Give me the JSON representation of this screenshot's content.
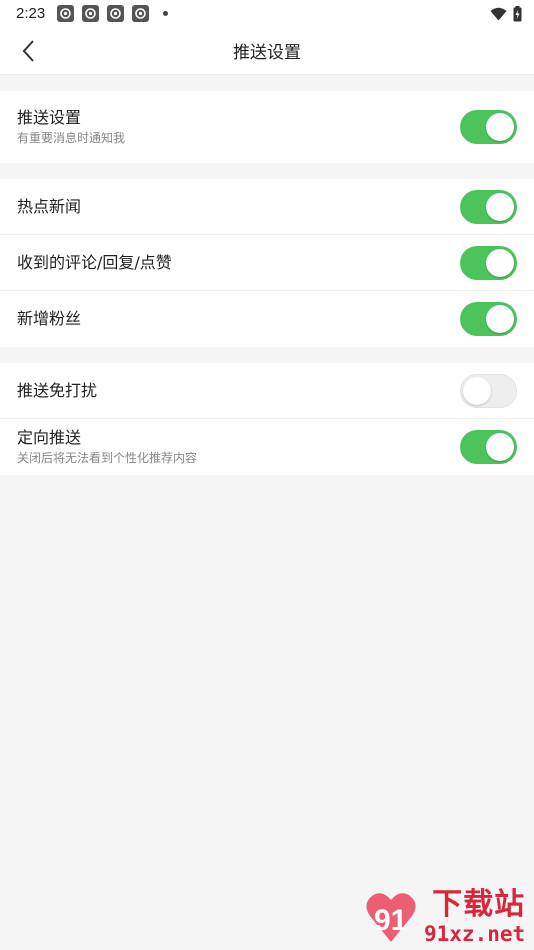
{
  "status_bar": {
    "time": "2:23",
    "notification_icons": [
      "app-notification-icon",
      "app-notification-icon",
      "app-notification-icon",
      "app-notification-icon"
    ],
    "more_dot": "•"
  },
  "header": {
    "title": "推送设置",
    "back_icon": "chevron-left-icon"
  },
  "groups": [
    {
      "items": [
        {
          "title": "推送设置",
          "subtitle": "有重要消息时通知我",
          "enabled": true
        }
      ]
    },
    {
      "items": [
        {
          "title": "热点新闻",
          "enabled": true
        },
        {
          "title": "收到的评论/回复/点赞",
          "enabled": true
        },
        {
          "title": "新增粉丝",
          "enabled": true
        }
      ]
    },
    {
      "items": [
        {
          "title": "推送免打扰",
          "enabled": false
        },
        {
          "title": "定向推送",
          "subtitle": "关闭后将无法看到个性化推荐内容",
          "enabled": true
        }
      ]
    }
  ],
  "watermark": {
    "chinese": "下载站",
    "url": "91xz.net"
  },
  "colors": {
    "toggle_on": "#4cc35b",
    "toggle_off": "#eeeeee",
    "background": "#f5f5f5",
    "watermark": "#d9263c"
  }
}
